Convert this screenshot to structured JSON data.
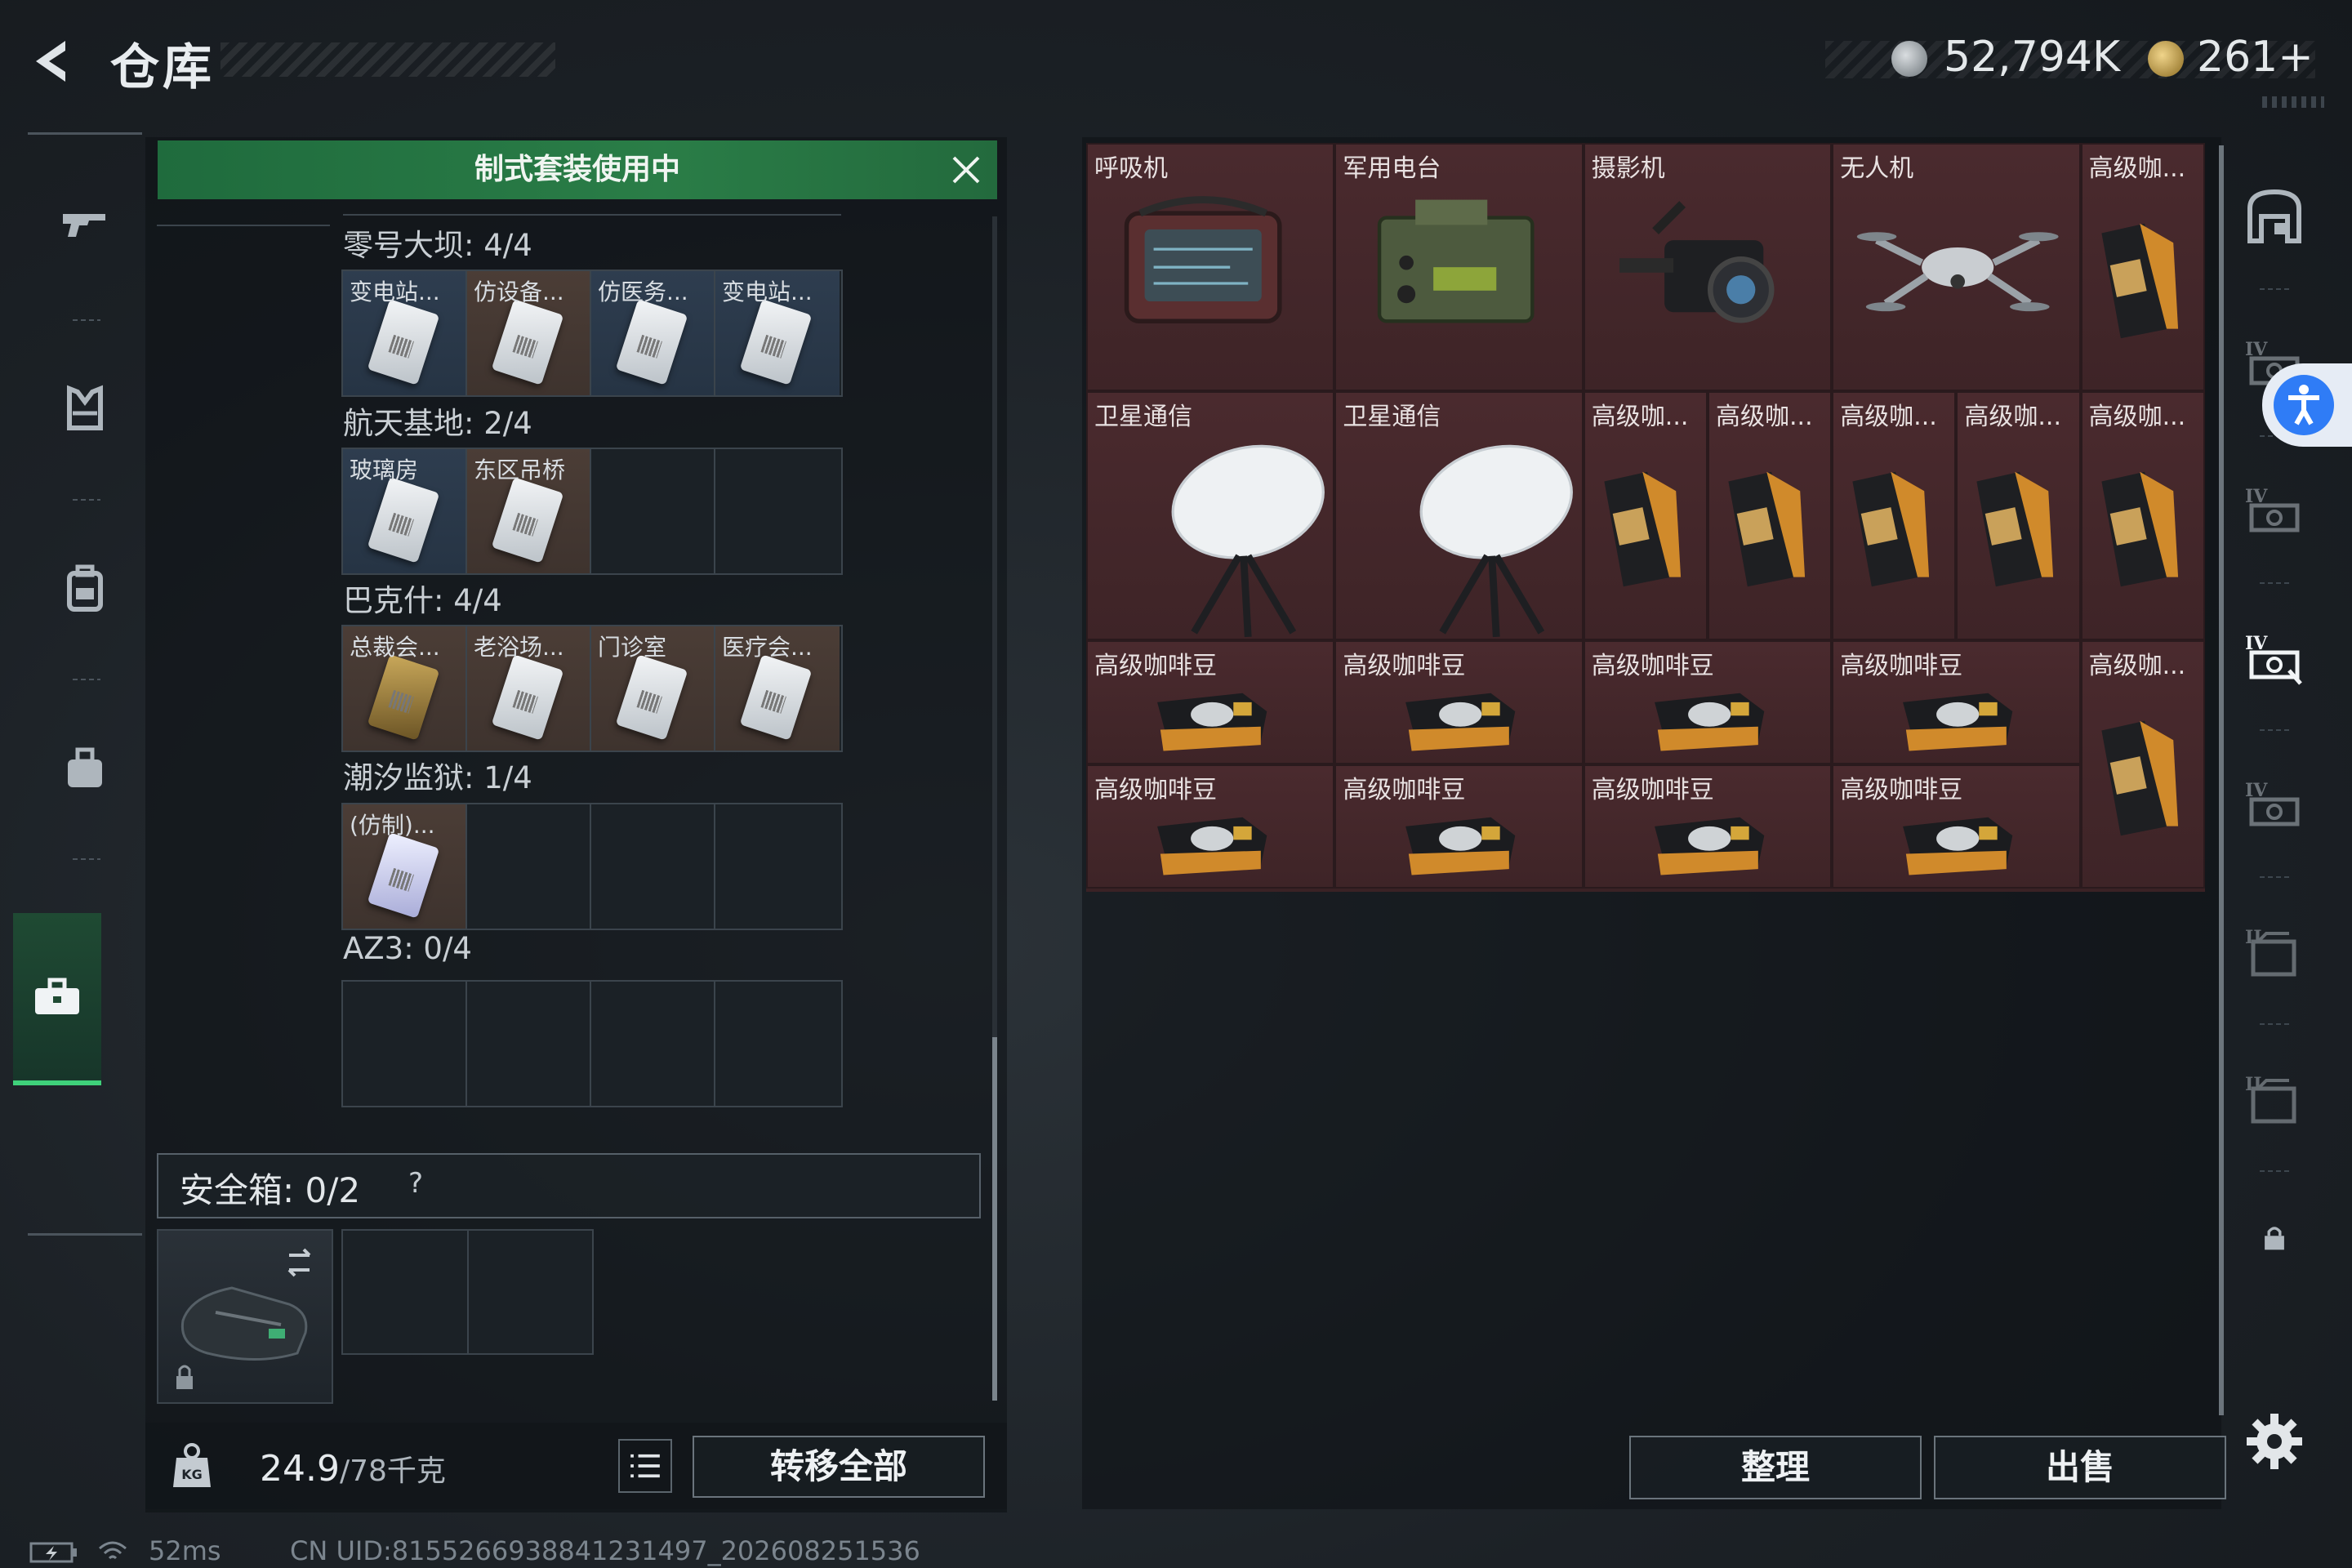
{
  "header": {
    "title": "仓库",
    "currency_1": "52,794K",
    "currency_2": "261+"
  },
  "left_nav": {
    "items": [
      "weapon-icon",
      "armor-icon",
      "backpack-icon",
      "bag-icon",
      "case-icon",
      "toolbox-icon"
    ],
    "active": "toolbox-icon"
  },
  "banner": {
    "text": "制式套装使用中"
  },
  "sections": [
    {
      "label": "零号大坝: 4/4",
      "slots": [
        {
          "label": "变电站...",
          "color": "blue",
          "card": "white"
        },
        {
          "label": "仿设备...",
          "color": "brown",
          "card": "white"
        },
        {
          "label": "仿医务...",
          "color": "blue",
          "card": "white"
        },
        {
          "label": "变电站...",
          "color": "blue",
          "card": "white"
        }
      ]
    },
    {
      "label": "航天基地: 2/4",
      "slots": [
        {
          "label": "玻璃房",
          "color": "blue",
          "card": "white"
        },
        {
          "label": "东区吊桥",
          "color": "brown",
          "card": "white"
        },
        {
          "label": "",
          "color": "empty"
        },
        {
          "label": "",
          "color": "empty"
        }
      ]
    },
    {
      "label": "巴克什: 4/4",
      "slots": [
        {
          "label": "总裁会...",
          "color": "brown",
          "card": "gold"
        },
        {
          "label": "老浴场...",
          "color": "brown",
          "card": "white"
        },
        {
          "label": "门诊室",
          "color": "brown",
          "card": "white"
        },
        {
          "label": "医疗会...",
          "color": "brown",
          "card": "white"
        }
      ]
    },
    {
      "label": "潮汐监狱: 1/4",
      "slots": [
        {
          "label": "(仿制)...",
          "color": "brown",
          "card": "purple"
        },
        {
          "label": "",
          "color": "empty"
        },
        {
          "label": "",
          "color": "empty"
        },
        {
          "label": "",
          "color": "empty"
        }
      ]
    },
    {
      "label": "AZ3: 0/4",
      "slots": [
        {
          "label": "",
          "color": "empty"
        },
        {
          "label": "",
          "color": "empty"
        },
        {
          "label": "",
          "color": "empty"
        },
        {
          "label": "",
          "color": "empty"
        }
      ]
    }
  ],
  "safebox": {
    "label": "安全箱:  0/2",
    "help": "?"
  },
  "bottom_left": {
    "weight_value": "24.9",
    "weight_unit": "/78千克",
    "kg_icon_text": "KG",
    "transfer_all": "转移全部"
  },
  "storage_items": [
    {
      "label": "呼吸机",
      "icon": "respirator-icon"
    },
    {
      "label": "军用电台",
      "icon": "military-radio-icon"
    },
    {
      "label": "摄影机",
      "icon": "video-camera-icon"
    },
    {
      "label": "无人机",
      "icon": "drone-icon"
    },
    {
      "label": "高级咖...",
      "icon": "coffee-bag-icon"
    },
    {
      "label": "卫星通信",
      "icon": "satellite-dish-icon"
    },
    {
      "label": "卫星通信",
      "icon": "satellite-dish-icon"
    },
    {
      "label": "高级咖...",
      "icon": "coffee-bag-icon"
    },
    {
      "label": "高级咖...",
      "icon": "coffee-bag-icon"
    },
    {
      "label": "高级咖...",
      "icon": "coffee-bag-icon"
    },
    {
      "label": "高级咖...",
      "icon": "coffee-bag-icon"
    },
    {
      "label": "高级咖...",
      "icon": "coffee-bag-icon"
    },
    {
      "label": "高级咖啡豆",
      "icon": "coffee-box-icon"
    },
    {
      "label": "高级咖啡豆",
      "icon": "coffee-box-icon"
    },
    {
      "label": "高级咖啡豆",
      "icon": "coffee-box-icon"
    },
    {
      "label": "高级咖啡豆",
      "icon": "coffee-box-icon"
    },
    {
      "label": "高级咖...",
      "icon": "coffee-bag-icon"
    },
    {
      "label": "高级咖啡豆",
      "icon": "coffee-box-icon"
    },
    {
      "label": "高级咖啡豆",
      "icon": "coffee-box-icon"
    },
    {
      "label": "高级咖啡豆",
      "icon": "coffee-box-icon"
    },
    {
      "label": "高级咖啡豆",
      "icon": "coffee-box-icon"
    }
  ],
  "right_nav": {
    "items": [
      "home-safe-icon",
      "storage-iv-icon",
      "storage-iv-icon",
      "storage-iv-icon",
      "storage-iv-icon",
      "storage-ii-icon",
      "storage-ii-icon",
      "lock-icon"
    ],
    "active_index": 3
  },
  "bottom_right": {
    "sort": "整理",
    "sell": "出售"
  },
  "status": {
    "ping": "52ms",
    "uid": "CN UID:8155266938841231497_202608251536"
  },
  "colors": {
    "accent_green": "#2a7d47",
    "cell_bg": "#4a2a2e",
    "active_nav": "#3fd17a"
  }
}
